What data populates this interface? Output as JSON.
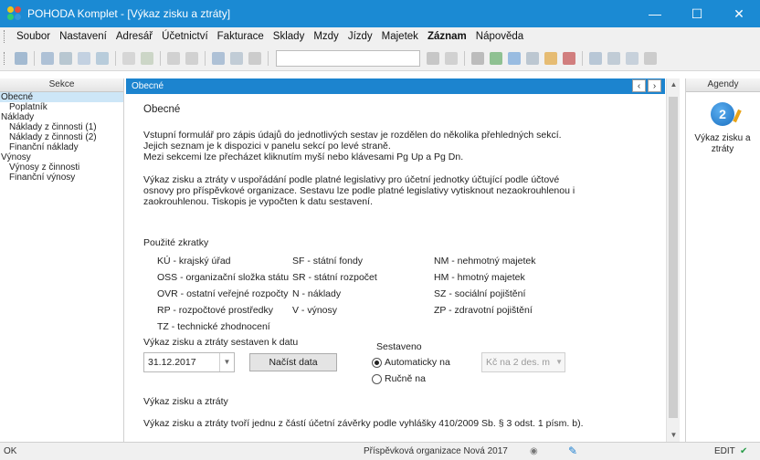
{
  "window": {
    "title": "POHODA Komplet - [Výkaz zisku a ztráty]",
    "controls": [
      "minimize-icon",
      "maximize-icon",
      "close-icon"
    ]
  },
  "menu": {
    "items": [
      "Soubor",
      "Nastavení",
      "Adresář",
      "Účetnictví",
      "Fakturace",
      "Sklady",
      "Mzdy",
      "Jízdy",
      "Majetek",
      "Záznam",
      "Nápověda"
    ]
  },
  "sections": {
    "header": "Sekce",
    "items": [
      {
        "label": "Obecné",
        "level": 0,
        "active": true
      },
      {
        "label": "Poplatník",
        "level": 1
      },
      {
        "label": "Náklady",
        "level": 0
      },
      {
        "label": "Náklady z činnosti (1)",
        "level": 1
      },
      {
        "label": "Náklady z činnosti (2)",
        "level": 1
      },
      {
        "label": "Finanční náklady",
        "level": 1
      },
      {
        "label": "Výnosy",
        "level": 0
      },
      {
        "label": "Výnosy z činnosti",
        "level": 1
      },
      {
        "label": "Finanční výnosy",
        "level": 1
      }
    ]
  },
  "main": {
    "header": "Obecné",
    "heading": "Obecné",
    "intro": [
      "Vstupní formulář pro zápis údajů do jednotlivých sestav je rozdělen do několika přehledných sekcí.",
      "Jejich seznam je k dispozici v panelu sekcí po levé straně.",
      "Mezi sekcemi lze přecházet kliknutím myší nebo klávesami Pg Up a Pg Dn."
    ],
    "description": [
      "Výkaz zisku a ztráty v uspořádání podle platné legislativy pro účetní jednotky účtující podle účtové",
      "osnovy pro příspěvkové organizace. Sestavu lze podle platné legislativy vytisknout nezaokrouhlenou i",
      "zaokrouhlenou. Tiskopis je vypočten k datu sestavení."
    ],
    "abbrev_title": "Použité zkratky",
    "abbrev_columns": [
      [
        "KÚ - krajský úřad",
        "OSS - organizační složka státu",
        "OVR - ostatní veřejné rozpočty",
        "RP - rozpočtové prostředky",
        "TZ - technické zhodnocení"
      ],
      [
        "SF - státní fondy",
        "SR - státní rozpočet",
        "N - náklady",
        "V - výnosy"
      ],
      [
        "NM - nehmotný majetek",
        "HM - hmotný majetek",
        "SZ - sociální pojištění",
        "ZP - zdravotní pojištění"
      ]
    ],
    "date_label": "Výkaz zisku a ztráty sestaven k datu",
    "date_value": "31.12.2017",
    "load_button": "Načíst data",
    "sestaveno_label": "Sestaveno",
    "radio_auto": "Automaticky na",
    "radio_manual": "Ručně na",
    "rounding_value": "Kč na 2 des. m",
    "rounding_selected": "auto",
    "report_heading": "Výkaz zisku a ztráty",
    "report_note": "Výkaz zisku a ztráty tvoří jednu z částí účetní závěrky podle vyhlášky 410/2009 Sb. § 3 odst. 1 písm. b)."
  },
  "agendy": {
    "header": "Agendy",
    "item_label": "Výkaz zisku a ztráty",
    "icon": "report-icon"
  },
  "status": {
    "left": "OK",
    "company": "Příspěvková organizace Nová 2017",
    "mode": "EDIT"
  }
}
